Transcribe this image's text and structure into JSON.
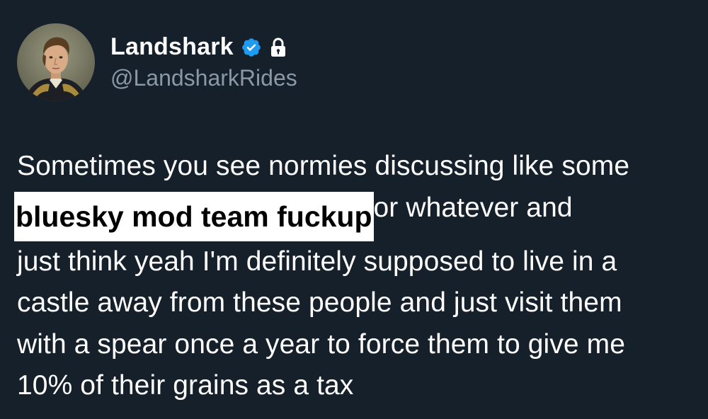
{
  "tweet": {
    "author": {
      "display_name": "Landshark",
      "handle": "@LandsharkRides",
      "verified": true,
      "protected": true,
      "avatar_icon": "portrait-avatar-icon"
    },
    "text": {
      "line1": "Sometimes you see normies discussing like some",
      "highlighted": "bluesky mod team fuckup",
      "line2_rest": "or whatever and",
      "line3": "just think yeah I'm definitely supposed to live in a",
      "line4": "castle away from these people and just visit them",
      "line5": "with a spear once a year to force them to give me",
      "line6": "10% of their grains as a tax"
    }
  },
  "colors": {
    "background": "#15202b",
    "text": "#ffffff",
    "handle": "#8b98a5",
    "verified_badge": "#1d9bf0",
    "highlight_bg": "#ffffff",
    "highlight_text": "#000000"
  }
}
